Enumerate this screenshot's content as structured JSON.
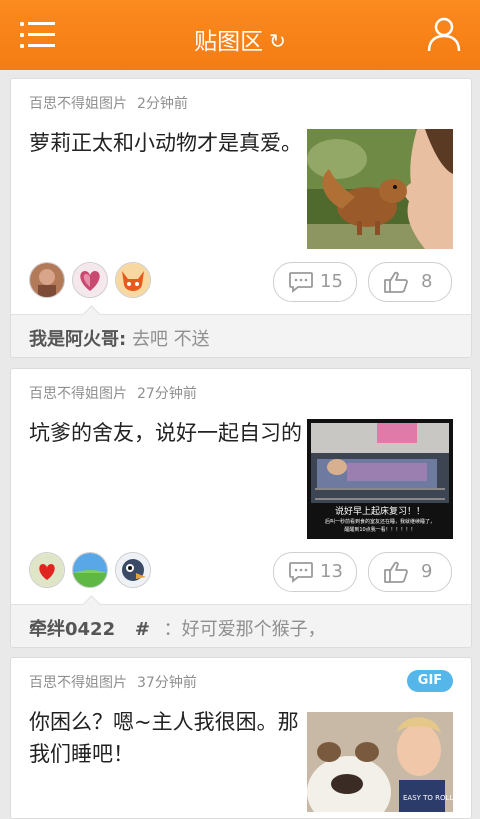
{
  "header": {
    "title": "贴图区",
    "refresh_glyph": "↻",
    "menu_icon": "menu-icon",
    "user_icon": "user-icon"
  },
  "posts": [
    {
      "source": "百思不得姐图片",
      "time": "2分钟前",
      "text": "萝莉正太和小动物才是真爱。",
      "comment_count": "15",
      "like_count": "8",
      "comment_user": "我是阿火哥:",
      "comment_text": "去吧 不送"
    },
    {
      "source": "百思不得姐图片",
      "time": "27分钟前",
      "text": "坑爹的舍友，说好一起自习的",
      "image_caption_1": "说好早上起床复习！！",
      "image_caption_2": "后叫一秒前看到食的室友还在睡，我就继续睡了，",
      "image_caption_3": "醒醒到10点我一看！！！！！！",
      "comment_count": "13",
      "like_count": "9",
      "comment_user": "牵绊0422",
      "comment_sep": "#",
      "comment_text": "：好可爱那个猴子，"
    },
    {
      "source": "百思不得姐图片",
      "time": "37分钟前",
      "badge": "GIF",
      "text": "你困么？嗯~主人我很困。那我们睡吧！"
    }
  ],
  "colors": {
    "header": "#f47c13",
    "gif_badge": "#55b6ea"
  }
}
